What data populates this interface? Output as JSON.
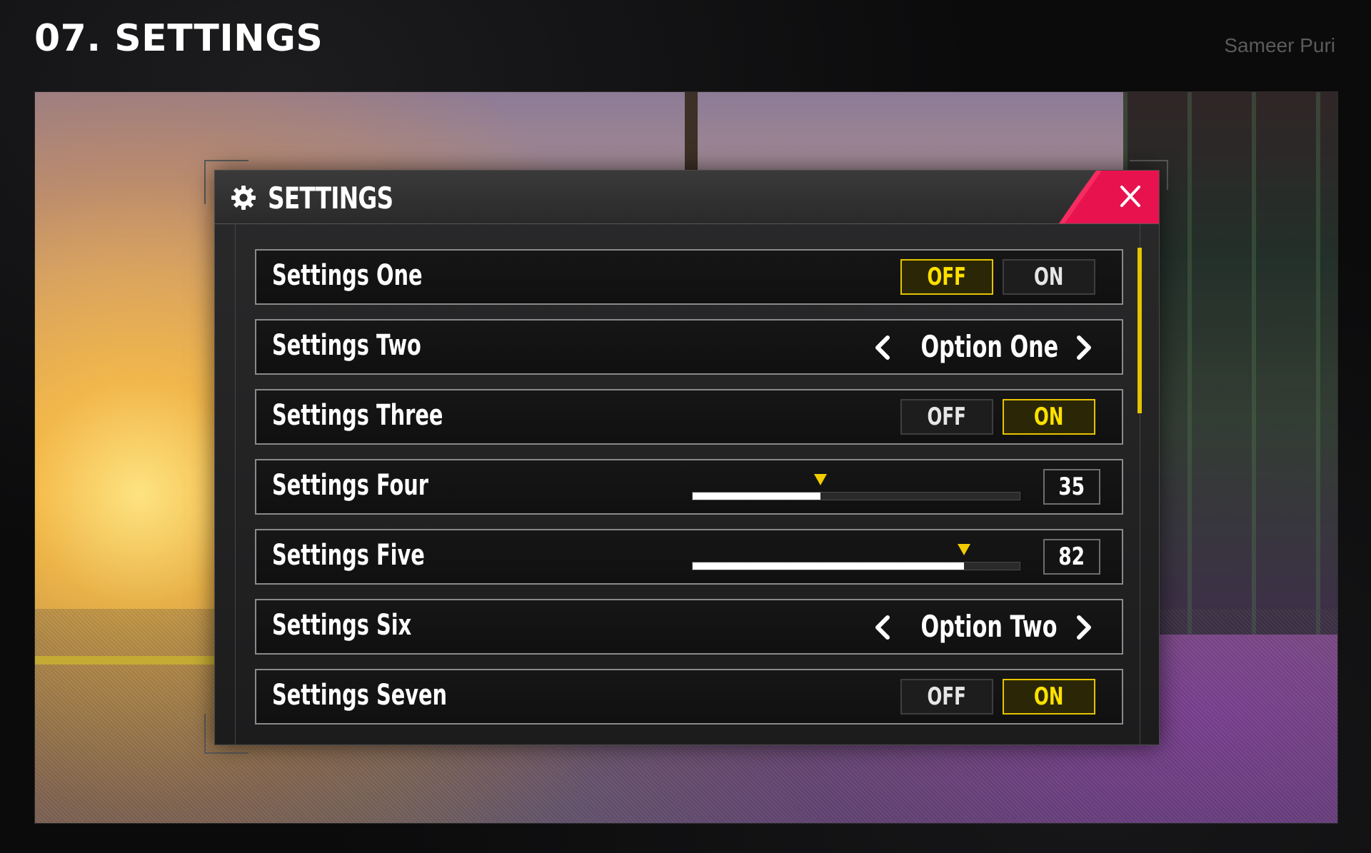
{
  "page": {
    "heading": "07. SETTINGS",
    "author": "Sameer Puri"
  },
  "panel": {
    "title": "SETTINGS",
    "close_icon": "close-icon",
    "gear_icon": "gear-icon",
    "accent_color": "#e5c400",
    "close_color": "#e8124f"
  },
  "settings": [
    {
      "label": "Settings One",
      "type": "toggle",
      "off": "OFF",
      "on": "ON",
      "selected": "OFF"
    },
    {
      "label": "Settings Two",
      "type": "selector",
      "value": "Option One"
    },
    {
      "label": "Settings Three",
      "type": "toggle",
      "off": "OFF",
      "on": "ON",
      "selected": "ON"
    },
    {
      "label": "Settings Four",
      "type": "slider",
      "value": "35",
      "level": 0.39
    },
    {
      "label": "Settings Five",
      "type": "slider",
      "value": "82",
      "level": 0.83
    },
    {
      "label": "Settings Six",
      "type": "selector",
      "value": "Option Two"
    },
    {
      "label": "Settings Seven",
      "type": "toggle",
      "off": "OFF",
      "on": "ON",
      "selected": "ON"
    }
  ]
}
